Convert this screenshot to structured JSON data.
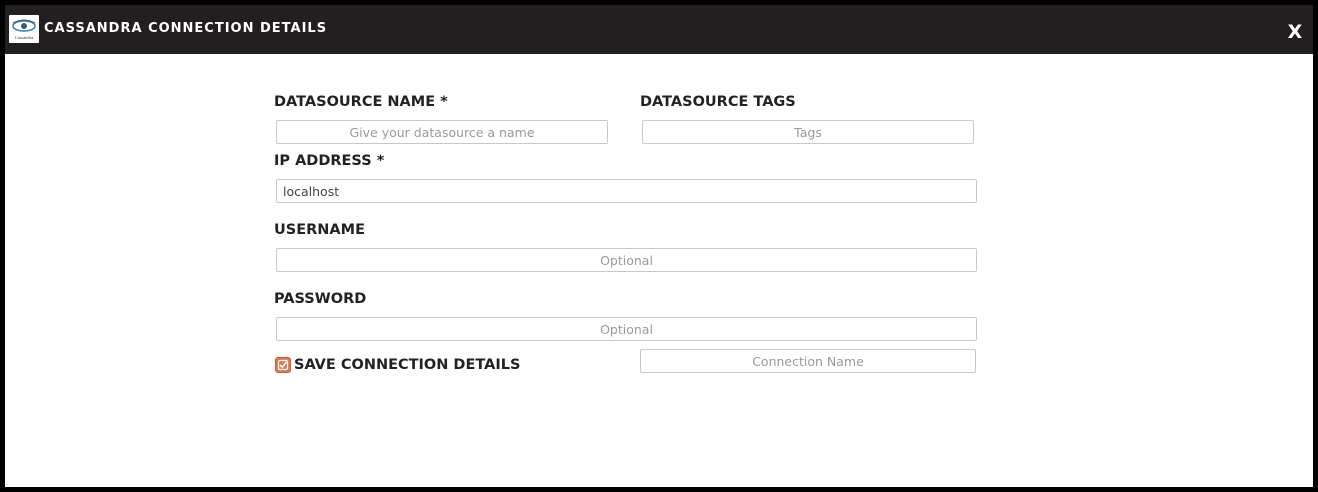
{
  "window": {
    "title": "CASSANDRA CONNECTION DETAILS",
    "logo_text": "Cassandra",
    "close_label": "X"
  },
  "form": {
    "datasource_name": {
      "label": "DATASOURCE NAME *",
      "placeholder": "Give your datasource a name",
      "value": ""
    },
    "datasource_tags": {
      "label": "DATASOURCE TAGS",
      "placeholder": "Tags",
      "value": ""
    },
    "ip_address": {
      "label": "IP ADDRESS *",
      "placeholder": "",
      "value": "localhost"
    },
    "username": {
      "label": "USERNAME",
      "placeholder": "Optional",
      "value": ""
    },
    "password": {
      "label": "PASSWORD",
      "placeholder": "Optional",
      "value": ""
    },
    "save_connection": {
      "label": "SAVE CONNECTION DETAILS",
      "checked": true
    },
    "connection_name": {
      "placeholder": "Connection Name",
      "value": ""
    }
  },
  "colors": {
    "titlebar": "#231f20",
    "checkbox_accent": "#e07a4f"
  },
  "icons": {
    "logo": "cassandra-eye-logo",
    "close": "close-icon",
    "checkbox": "checkmark-icon"
  }
}
